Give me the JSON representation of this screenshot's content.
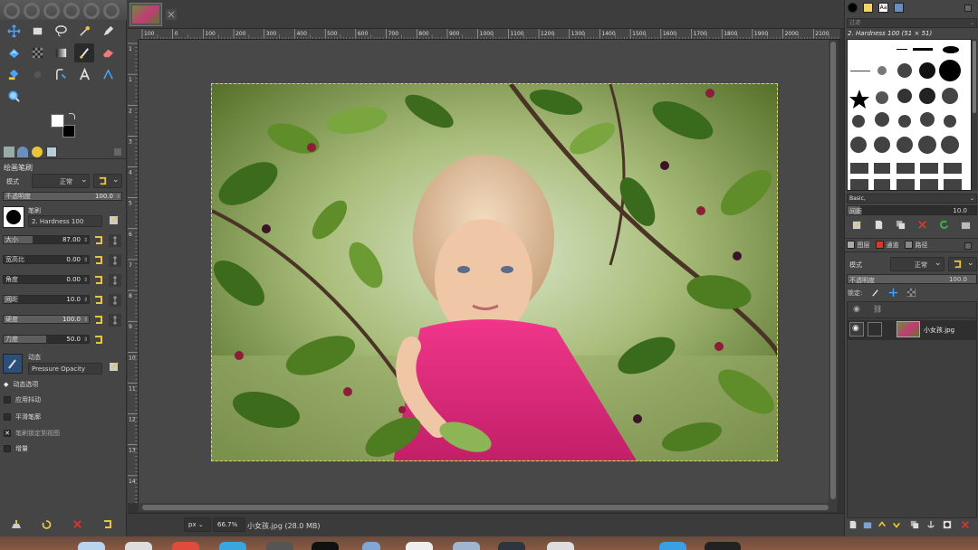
{
  "canvas": {
    "status_unit": "px",
    "status_zoom": "66.7%",
    "status_file": "小女孩.jpg (28.0 MB)",
    "ruler_labels": [
      "100",
      "0",
      "100",
      "200",
      "300",
      "400",
      "500",
      "600",
      "700",
      "800",
      "900",
      "1000",
      "1100",
      "1200",
      "1300",
      "1400",
      "1500",
      "1600",
      "1700",
      "1800",
      "1900",
      "2000",
      "2100"
    ],
    "vruler_labels": [
      "1",
      "1",
      "2",
      "3",
      "4",
      "5",
      "6",
      "7",
      "8",
      "9",
      "10",
      "11",
      "12",
      "13",
      "14"
    ]
  },
  "tool_options": {
    "title": "绘画笔刷",
    "mode_label": "模式",
    "mode_value": "正常",
    "opacity_label": "不透明度",
    "opacity_value": "100.0",
    "brush_label": "笔刷",
    "brush_name": "2. Hardness 100",
    "size_label": "大小",
    "size_value": "87.00",
    "aspect_label": "宽高比",
    "aspect_value": "0.00",
    "angle_label": "角度",
    "angle_value": "0.00",
    "spacing_label": "间距",
    "spacing_value": "10.0",
    "hardness_label": "硬度",
    "hardness_value": "100.0",
    "force_label": "力度",
    "force_value": "50.0",
    "dynamics_label": "动态",
    "dynamics_value": "Pressure Opacity",
    "dynamics_options_label": "动态选项",
    "jitter_label": "应用抖动",
    "smooth_label": "平滑笔廓",
    "lock_brush_label": "笔刷锁定到视图",
    "incremental_label": "增量",
    "size_fraction": 0.34,
    "hardness_fraction": 1.0,
    "force_fraction": 0.5,
    "opacity_fraction": 1.0
  },
  "brushes": {
    "filter_placeholder": "过滤",
    "selected": "2. Hardness 100 (51 × 51)",
    "preset": "Basic,",
    "spacing_label": "间距",
    "spacing_value": "10.0"
  },
  "layers": {
    "tab_layers": "图层",
    "tab_channels": "通道",
    "tab_paths": "路径",
    "mode_label": "模式",
    "mode_value": "正常",
    "opacity_label": "不透明度",
    "opacity_value": "100.0",
    "lock_label": "锁定:",
    "layer_name": "小女孩.jpg"
  },
  "colors": {
    "accent_yellow": "#e8c53a",
    "red": "#d9372c",
    "green": "#3bb54a",
    "panel": "#454545",
    "canvas_bg": "#484848"
  },
  "icons": {
    "move": "move-icon",
    "rect": "rect-select-icon",
    "lasso": "lasso-icon",
    "wand": "fuzzy-select-icon",
    "pen": "path-icon"
  }
}
